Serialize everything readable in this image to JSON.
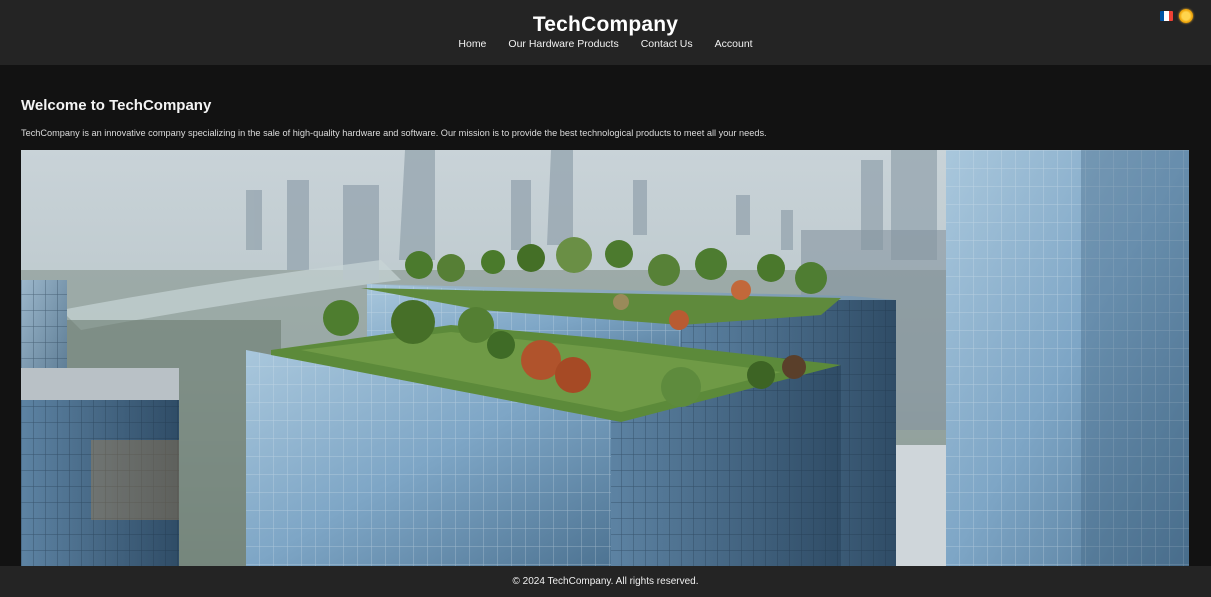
{
  "header": {
    "brand": "TechCompany",
    "nav": [
      "Home",
      "Our Hardware Products",
      "Contact Us",
      "Account"
    ]
  },
  "lang": {
    "flag_colors": [
      "#0055a4",
      "#ffffff",
      "#ef4135"
    ],
    "theme_icon": "sun-icon"
  },
  "main": {
    "welcome_title": "Welcome to TechCompany",
    "intro_text": "TechCompany is an innovative company specializing in the sale of high-quality hardware and software. Our mission is to provide the best technological products to meet all your needs."
  },
  "footer": {
    "copyright": "© 2024 TechCompany. All rights reserved."
  }
}
